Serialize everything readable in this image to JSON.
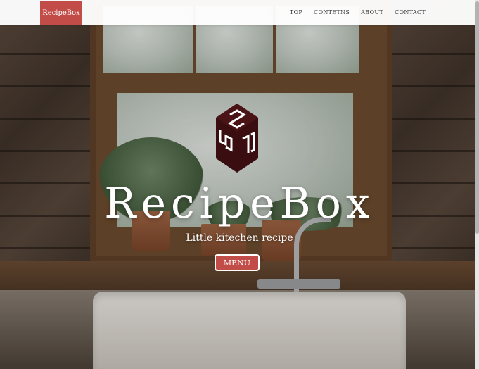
{
  "navbar": {
    "brand": "RecipeBox",
    "links": [
      "TOP",
      "CONTETNS",
      "ABOUT",
      "CONTACT"
    ]
  },
  "hero": {
    "title": "RecipeBox",
    "subtitle": "Little kitechen recipe",
    "button_label": "MENU"
  },
  "colors": {
    "accent": "#c14c48",
    "logo": "#3a0e10",
    "nav_bg": "#ffffff",
    "text_on_hero": "#ffffff"
  },
  "icons": {
    "logo": "recipebox-cube-logo"
  }
}
